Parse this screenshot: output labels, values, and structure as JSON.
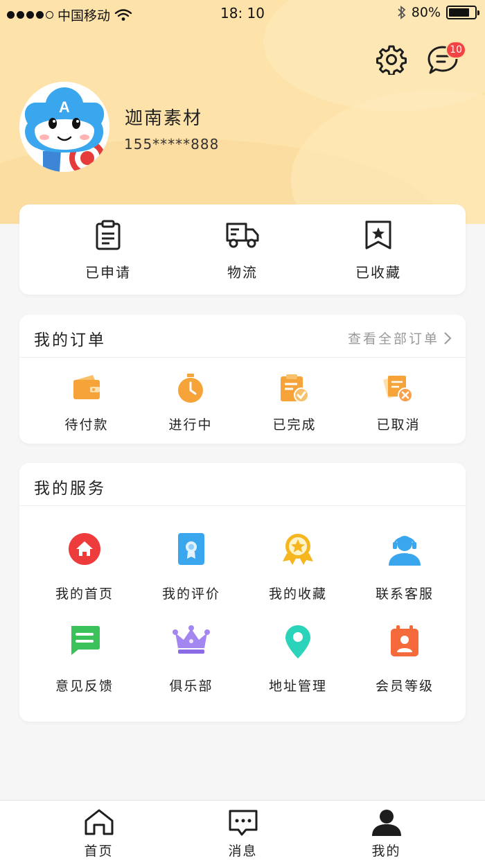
{
  "status_bar": {
    "carrier": "中国移动",
    "time": "18: 10",
    "battery": "80%",
    "battery_level": 0.8
  },
  "header": {
    "settings_icon": "gear-icon",
    "messages_icon": "chat-bubble-icon",
    "messages_badge": "10"
  },
  "profile": {
    "name": "迦南素材",
    "phone": "155*****888",
    "avatar_icon": "mascot-avatar"
  },
  "quick_actions": [
    {
      "label": "已申请",
      "icon": "clipboard-icon"
    },
    {
      "label": "物流",
      "icon": "truck-icon"
    },
    {
      "label": "已收藏",
      "icon": "star-bookmark-icon"
    }
  ],
  "orders": {
    "title": "我的订单",
    "view_all": "查看全部订单",
    "items": [
      {
        "label": "待付款",
        "icon": "wallet-icon"
      },
      {
        "label": "进行中",
        "icon": "timer-icon"
      },
      {
        "label": "已完成",
        "icon": "checked-clipboard-icon"
      },
      {
        "label": "已取消",
        "icon": "cancelled-docs-icon"
      }
    ]
  },
  "services": {
    "title": "我的服务",
    "items": [
      {
        "label": "我的首页",
        "icon": "home-icon"
      },
      {
        "label": "我的评价",
        "icon": "certificate-icon"
      },
      {
        "label": "我的收藏",
        "icon": "medal-icon"
      },
      {
        "label": "联系客服",
        "icon": "headset-agent-icon"
      },
      {
        "label": "意见反馈",
        "icon": "feedback-message-icon"
      },
      {
        "label": "俱乐部",
        "icon": "crown-icon"
      },
      {
        "label": "地址管理",
        "icon": "location-pin-icon"
      },
      {
        "label": "会员等级",
        "icon": "member-card-icon"
      }
    ]
  },
  "tab_bar": {
    "items": [
      {
        "label": "首页",
        "icon": "home-outline-icon"
      },
      {
        "label": "消息",
        "icon": "message-outline-icon"
      },
      {
        "label": "我的",
        "icon": "person-icon"
      }
    ]
  },
  "colors": {
    "header_bg": "#fde3a9",
    "accent_orange": "#f6a33a",
    "badge_red": "#f24444"
  }
}
